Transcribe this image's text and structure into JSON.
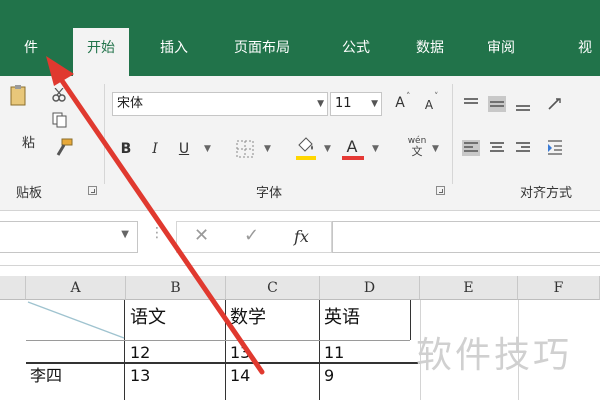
{
  "tabs": [
    {
      "label": "件",
      "active": false
    },
    {
      "label": "开始",
      "active": true
    },
    {
      "label": "插入",
      "active": false
    },
    {
      "label": "页面布局",
      "active": false
    },
    {
      "label": "公式",
      "active": false
    },
    {
      "label": "数据",
      "active": false
    },
    {
      "label": "审阅",
      "active": false
    },
    {
      "label": "视",
      "active": false
    }
  ],
  "ribbon": {
    "clipboard": {
      "paste_label": "粘",
      "group_label": "贴板"
    },
    "font": {
      "name": "宋体",
      "size": "11",
      "grow_label": "A",
      "shrink_label": "A",
      "bold_label": "B",
      "italic_label": "I",
      "underline_label": "U",
      "font_color_label": "A",
      "phonetic_top": "wén",
      "phonetic_bottom": "文",
      "group_label": "字体"
    },
    "alignment": {
      "group_label": "对齐方式"
    }
  },
  "formula_bar": {
    "cancel_glyph": "✕",
    "enter_glyph": "✓",
    "fx_label": "fx",
    "value": ""
  },
  "sheet": {
    "columns": [
      "A",
      "B",
      "C",
      "D",
      "E",
      "F"
    ],
    "header_row": [
      "",
      "语文",
      "数学",
      "英语"
    ],
    "rows": [
      [
        "",
        "12",
        "13",
        "11"
      ],
      [
        "李四",
        "13",
        "14",
        "9"
      ]
    ]
  },
  "watermark": "软件技巧",
  "colors": {
    "ribbon_green": "#21734a",
    "ribbon_gray": "#f3f3f3",
    "annotation_arrow": "#e0392f",
    "font_color_bar": "#e53935",
    "highlight_bar": "#ffd600"
  }
}
